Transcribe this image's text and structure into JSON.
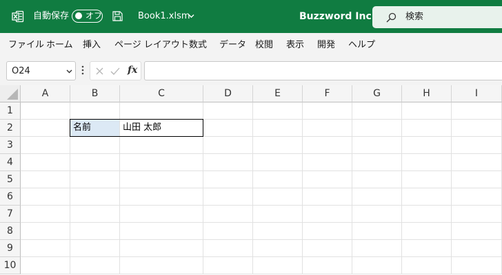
{
  "titlebar": {
    "autosave_label": "自動保存",
    "autosave_state": "オフ",
    "filename": "Book1.xlsm",
    "company": "Buzzword Inc.",
    "search_placeholder": "検索",
    "background_color": "#107c41"
  },
  "menu": [
    "ファイル",
    "ホーム",
    "挿入",
    "ページ レイアウト",
    "数式",
    "データ",
    "校閲",
    "表示",
    "開発",
    "ヘルプ"
  ],
  "formula_bar": {
    "name_box": "O24",
    "fx_label": "fx",
    "formula_value": ""
  },
  "grid": {
    "columns": [
      "A",
      "B",
      "C",
      "D",
      "E",
      "F",
      "G",
      "H",
      "I"
    ],
    "rows": [
      "1",
      "2",
      "3",
      "4",
      "5",
      "6",
      "7",
      "8",
      "9",
      "10"
    ],
    "cells": {
      "B2": "名前",
      "C2": "山田 太郎"
    },
    "highlight_color": "#dce9f5"
  }
}
